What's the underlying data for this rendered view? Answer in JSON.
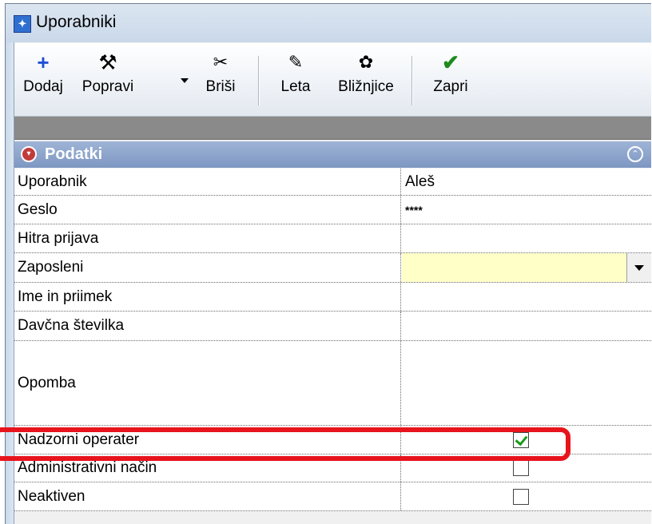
{
  "window": {
    "title": "Uporabniki"
  },
  "toolbar": {
    "add_label": "Dodaj",
    "edit_label": "Popravi",
    "delete_label": "Briši",
    "years_label": "Leta",
    "shortcuts_label": "Bližnjice",
    "close_label": "Zapri"
  },
  "section": {
    "title": "Podatki"
  },
  "fields": {
    "user": {
      "label": "Uporabnik",
      "value": "Aleš"
    },
    "password": {
      "label": "Geslo",
      "value": "****"
    },
    "quick_login": {
      "label": "Hitra prijava",
      "value": ""
    },
    "employee": {
      "label": "Zaposleni",
      "value": ""
    },
    "full_name": {
      "label": "Ime in priimek",
      "value": ""
    },
    "tax_number": {
      "label": "Davčna številka",
      "value": ""
    },
    "note": {
      "label": "Opomba",
      "value": ""
    },
    "supervisor": {
      "label": "Nadzorni operater",
      "checked": true
    },
    "admin_mode": {
      "label": "Administrativni način",
      "checked": false
    },
    "inactive": {
      "label": "Neaktiven",
      "checked": false
    }
  },
  "colors": {
    "highlight": "#e8141c",
    "section_bg": "#8aa3cb",
    "employee_field_bg": "#ffffc8"
  }
}
